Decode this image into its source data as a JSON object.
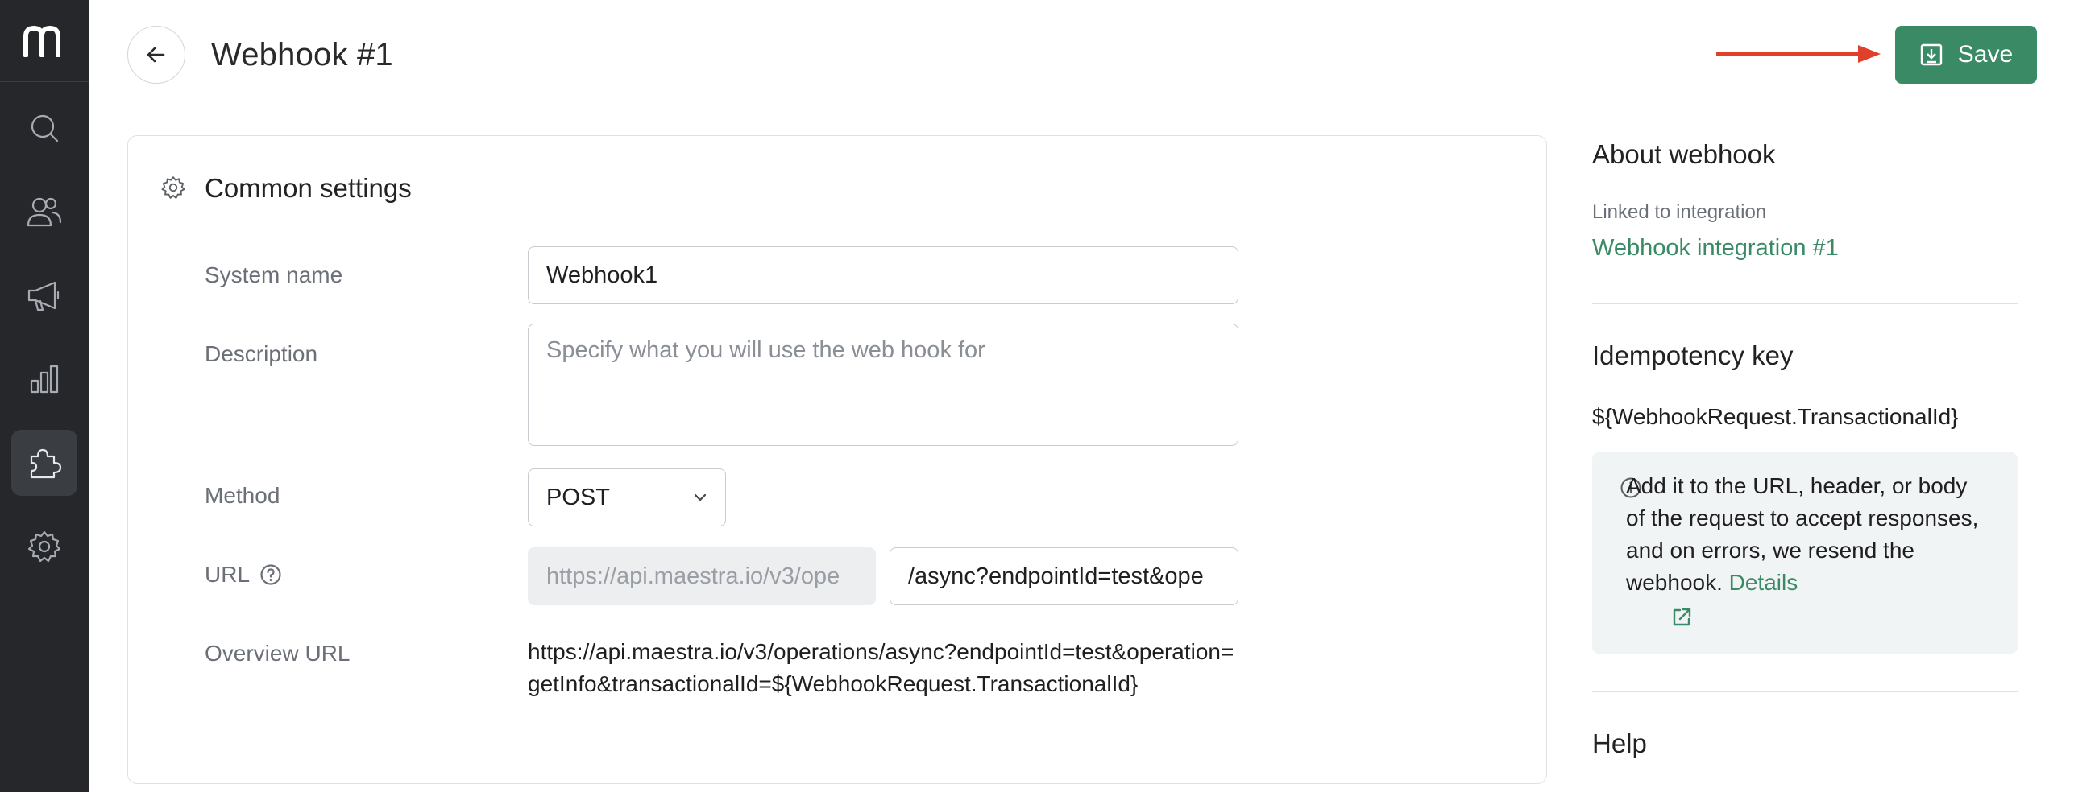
{
  "sidebar": {
    "logo": "m",
    "items": [
      {
        "icon": "search-icon"
      },
      {
        "icon": "users-icon"
      },
      {
        "icon": "megaphone-icon"
      },
      {
        "icon": "bar-chart-icon"
      },
      {
        "icon": "puzzle-icon",
        "active": true
      },
      {
        "icon": "gear-icon"
      }
    ]
  },
  "header": {
    "title": "Webhook #1",
    "save_label": "Save"
  },
  "common_settings": {
    "title": "Common settings",
    "system_name_label": "System name",
    "system_name_value": "Webhook1",
    "description_label": "Description",
    "description_placeholder": "Specify what you will use the web hook for",
    "method_label": "Method",
    "method_value": "POST",
    "url_label": "URL",
    "url_base": "https://api.maestra.io/v3/ope",
    "url_path": "/async?endpointId=test&ope",
    "overview_label": "Overview URL",
    "overview_value": "https://api.maestra.io/v3/operations/async?endpointId=test&operation=getInfo&transactionalId=${WebhookRequest.TransactionalId}"
  },
  "about": {
    "title": "About webhook",
    "linked_label": "Linked to integration",
    "linked_value": "Webhook integration #1",
    "idempotency_title": "Idempotency key",
    "idempotency_value": "${WebhookRequest.TransactionalId}",
    "info_text": "Add it to the URL, header, or body of the request to accept responses, and on errors, we resend the webhook. ",
    "info_link": "Details",
    "help_title": "Help"
  },
  "colors": {
    "accent": "#3a8a66",
    "sidebar": "#25272b",
    "arrow": "#e0402a"
  }
}
